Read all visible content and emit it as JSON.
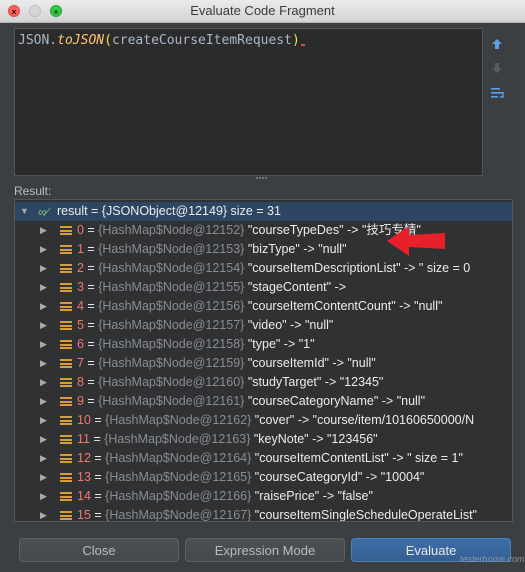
{
  "window": {
    "title": "Evaluate Code Fragment",
    "controls": {
      "close": "×",
      "minimize": "",
      "zoom": "+"
    }
  },
  "editor": {
    "prefix": "JSON.",
    "method": "toJSON",
    "open_paren": "(",
    "argument": "createCourseItemRequest",
    "close_paren": ")"
  },
  "result_label": "Result:",
  "result": {
    "root": {
      "text": "result = {JSONObject@12149}  size = 31"
    },
    "entries": [
      {
        "index": "0",
        "node": "{HashMap$Node@12152}",
        "text": "\"courseTypeDes\" -> \"技巧专精\""
      },
      {
        "index": "1",
        "node": "{HashMap$Node@12153}",
        "text": "\"bizType\" -> \"null\""
      },
      {
        "index": "2",
        "node": "{HashMap$Node@12154}",
        "text": "\"courseItemDescriptionList\" -> \" size = 0"
      },
      {
        "index": "3",
        "node": "{HashMap$Node@12155}",
        "text": "\"stageContent\" ->"
      },
      {
        "index": "4",
        "node": "{HashMap$Node@12156}",
        "text": "\"courseItemContentCount\" -> \"null\""
      },
      {
        "index": "5",
        "node": "{HashMap$Node@12157}",
        "text": "\"video\" -> \"null\""
      },
      {
        "index": "6",
        "node": "{HashMap$Node@12158}",
        "text": "\"type\" -> \"1\""
      },
      {
        "index": "7",
        "node": "{HashMap$Node@12159}",
        "text": "\"courseItemId\" -> \"null\""
      },
      {
        "index": "8",
        "node": "{HashMap$Node@12160}",
        "text": "\"studyTarget\" -> \"12345\""
      },
      {
        "index": "9",
        "node": "{HashMap$Node@12161}",
        "text": "\"courseCategoryName\" -> \"null\""
      },
      {
        "index": "10",
        "node": "{HashMap$Node@12162}",
        "text": "\"cover\" -> \"course/item/10160650000/N"
      },
      {
        "index": "11",
        "node": "{HashMap$Node@12163}",
        "text": "\"keyNote\" -> \"123456\""
      },
      {
        "index": "12",
        "node": "{HashMap$Node@12164}",
        "text": "\"courseItemContentList\" -> \" size = 1\""
      },
      {
        "index": "13",
        "node": "{HashMap$Node@12165}",
        "text": "\"courseCategoryId\" -> \"10004\""
      },
      {
        "index": "14",
        "node": "{HashMap$Node@12166}",
        "text": "\"raisePrice\" -> \"false\""
      },
      {
        "index": "15",
        "node": "{HashMap$Node@12167}",
        "text": "\"courseItemSingleScheduleOperateList\""
      }
    ]
  },
  "buttons": {
    "close": "Close",
    "expression_mode": "Expression Mode",
    "evaluate": "Evaluate"
  },
  "watermark": "testerhome.com",
  "colors": {
    "arrow": "#e8202a",
    "index": "#f0786b",
    "evaluate_button": "#3c6ea8"
  }
}
